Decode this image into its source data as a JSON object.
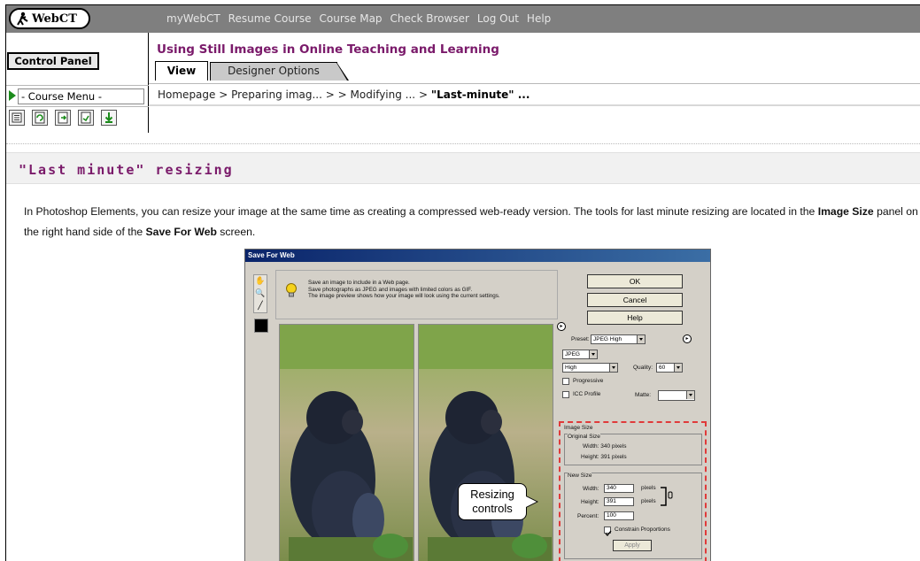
{
  "header": {
    "logo_text": "WebCT",
    "nav": [
      "myWebCT",
      "Resume Course",
      "Course Map",
      "Check Browser",
      "Log Out",
      "Help"
    ]
  },
  "left": {
    "control_panel": "Control Panel",
    "course_menu": "- Course Menu -"
  },
  "course": {
    "title": "Using Still Images in Online Teaching and Learning",
    "tabs": {
      "view": "View",
      "designer": "Designer Options"
    }
  },
  "breadcrumb": {
    "items": [
      "Homepage",
      "Preparing imag...",
      "",
      "Modifying ...",
      "\"Last-minute\" ..."
    ],
    "separator": ">"
  },
  "page": {
    "heading": "\"Last minute\" resizing",
    "body_parts": [
      "In Photoshop Elements, you can resize your image at the same time as creating a compressed web-ready version. The tools for last minute resizing are located in the ",
      "Image Size",
      " panel on the right hand side of the ",
      "Save For Web",
      " screen."
    ]
  },
  "screenshot": {
    "title": "Save For Web",
    "info_lines": [
      "Save an image to include in a Web page.",
      "Save photographs as JPEG and images with limited colors as GIF.",
      "The image preview shows how your image will look using the current settings."
    ],
    "buttons": {
      "ok": "OK",
      "cancel": "Cancel",
      "help": "Help"
    },
    "settings": {
      "preset_label": "Preset:",
      "preset_value": "JPEG High",
      "format_value": "JPEG",
      "quality_level": "High",
      "quality_label": "Quality:",
      "quality_value": "60",
      "progressive": "Progressive",
      "icc_profile": "ICC Profile",
      "matte_label": "Matte:"
    },
    "image_size": {
      "title": "Image Size",
      "original_title": "Original Size",
      "orig_width": "Width: 340 pixels",
      "orig_height": "Height: 391 pixels",
      "new_title": "New Size",
      "width_label": "Width:",
      "width_value": "340",
      "height_label": "Height:",
      "height_value": "391",
      "unit": "pixels",
      "percent_label": "Percent:",
      "percent_value": "100",
      "constrain": "Constrain Proportions",
      "apply": "Apply"
    },
    "callout": "Resizing controls"
  },
  "colors": {
    "topbar": "#7f7f7f",
    "title_purple": "#7a1a6a",
    "callout_border": "#e03a3a"
  }
}
